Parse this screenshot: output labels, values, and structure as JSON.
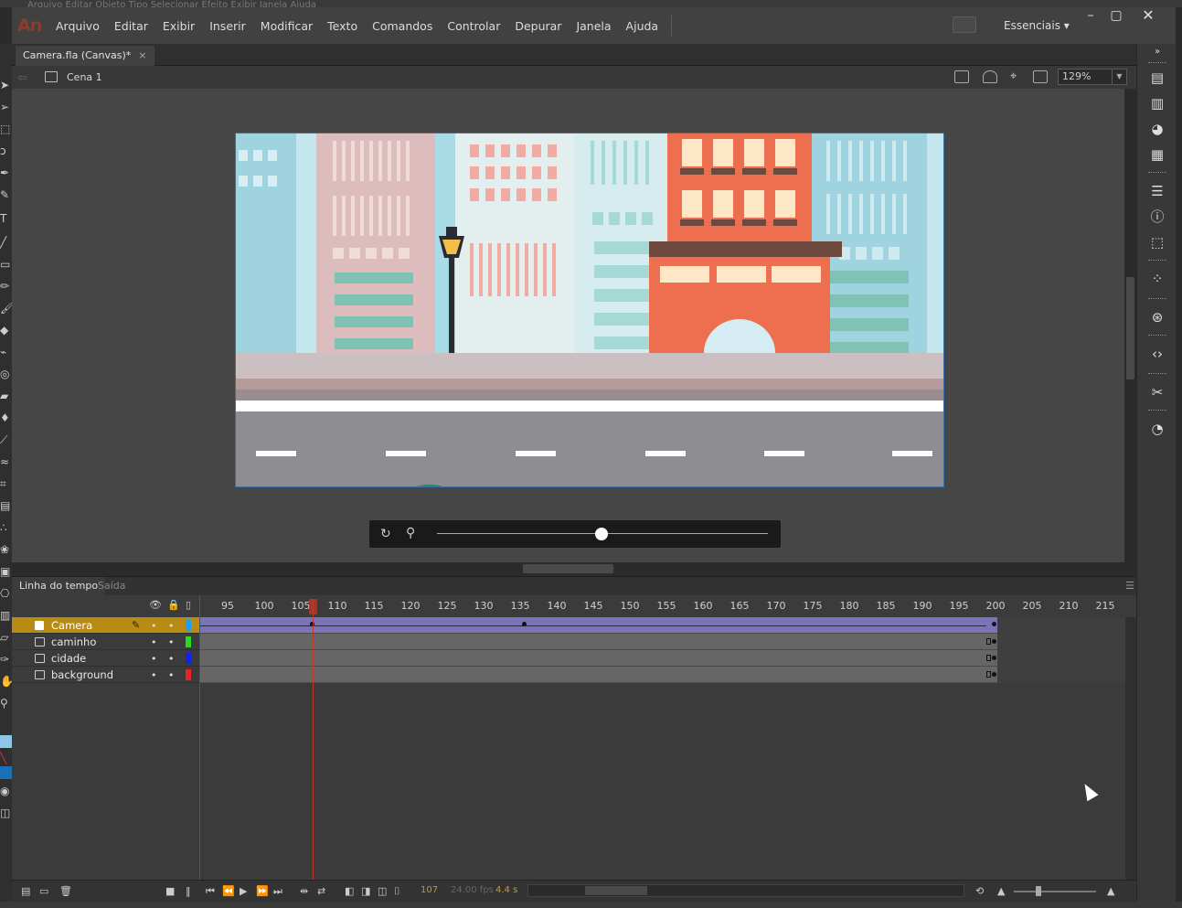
{
  "app": {
    "logo": "An",
    "bg_menu_strip": "Arquivo   Editar   Objeto   Tipo   Selecionar   Efeito   Exibir   Janela   Ajuda"
  },
  "menu": [
    "Arquivo",
    "Editar",
    "Exibir",
    "Inserir",
    "Modificar",
    "Texto",
    "Comandos",
    "Controlar",
    "Depurar",
    "Janela",
    "Ajuda"
  ],
  "workspace": {
    "label": "Essenciais ▾"
  },
  "window": {
    "minimize": "–",
    "maximize": "▢",
    "close": "✕"
  },
  "document": {
    "tab_label": "Camera.fla (Canvas)*",
    "close": "×"
  },
  "scene": {
    "label": "Cena 1"
  },
  "zoom": {
    "value": "129%"
  },
  "camera_bar": {
    "zoom_level": 0.5
  },
  "panels": {
    "timeline_tab": "Linha do tempo",
    "output_tab": "Saída"
  },
  "ruler": {
    "ticks": [
      "95",
      "100",
      "105",
      "110",
      "115",
      "120",
      "125",
      "130",
      "135",
      "140",
      "145",
      "150",
      "155",
      "160",
      "165",
      "170",
      "175",
      "180",
      "185",
      "190",
      "195",
      "200",
      "205",
      "210",
      "215"
    ]
  },
  "layers": [
    {
      "name": "Camera",
      "selected": true,
      "color": "#1aa0ff",
      "icon": "camera-icon"
    },
    {
      "name": "caminho",
      "selected": false,
      "color": "#22dd22",
      "icon": "layer-icon"
    },
    {
      "name": "cidade",
      "selected": false,
      "color": "#1122ee",
      "icon": "layer-icon"
    },
    {
      "name": "background",
      "selected": false,
      "color": "#ee2222",
      "icon": "layer-icon"
    }
  ],
  "timeline_status": {
    "current_frame": "107",
    "fps": "24.00 fps",
    "elapsed": "4.4 s"
  },
  "colors": {
    "selected_layer": "#b88c14",
    "tween": "#7a75b8",
    "playhead": "#c0392b",
    "stage_border": "#3d6ea8"
  }
}
